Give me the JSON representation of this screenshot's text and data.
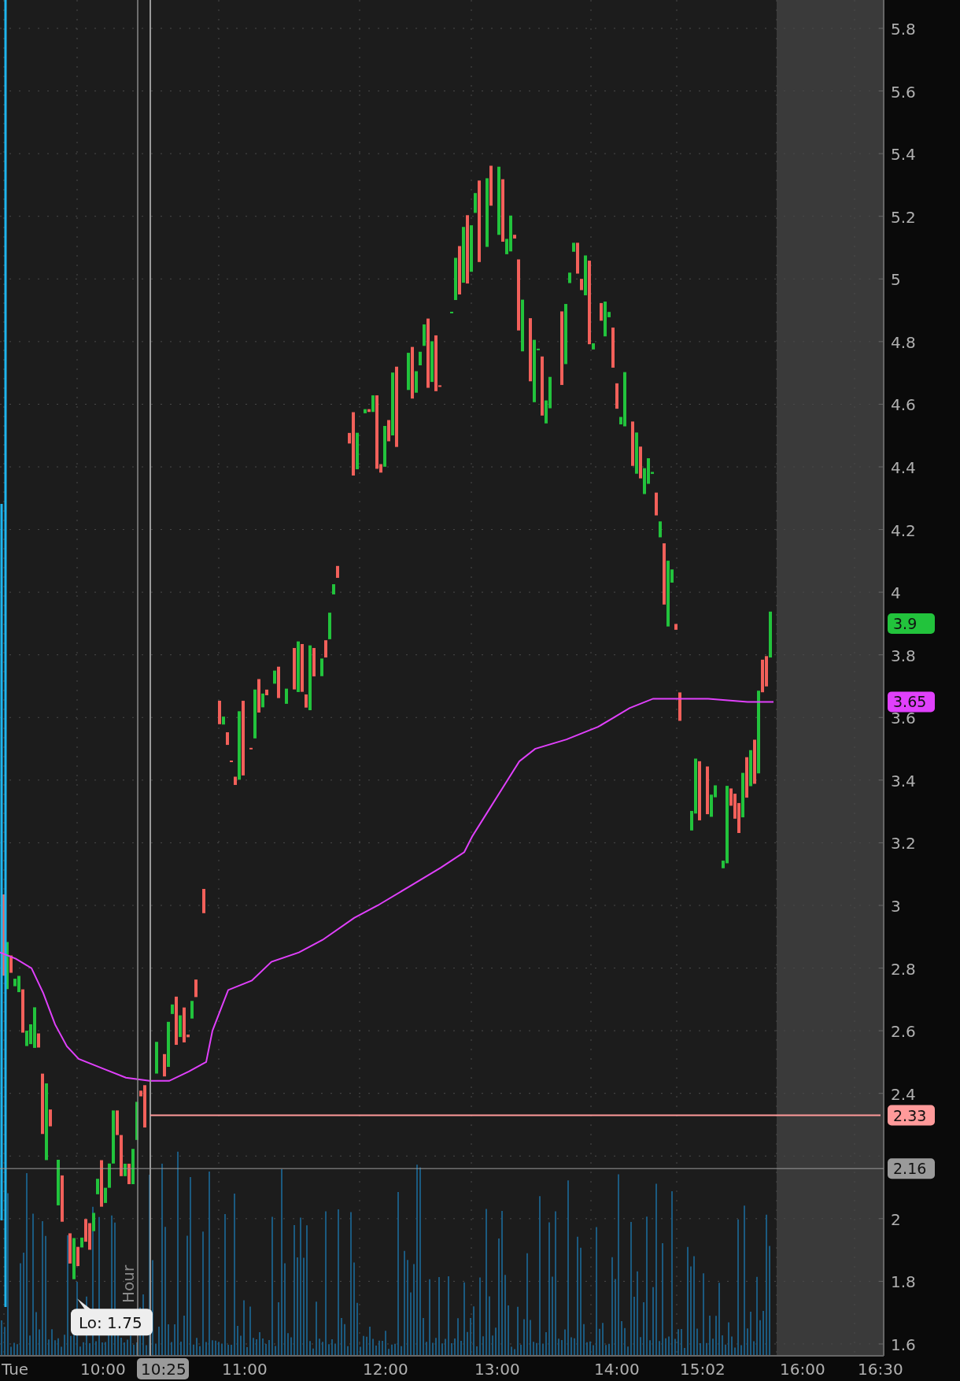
{
  "price_axis": {
    "labels": [
      "5.8",
      "5.6",
      "5.4",
      "5.2",
      "5",
      "4.8",
      "4.6",
      "4.4",
      "4.2",
      "4",
      "3.8",
      "3.6",
      "3.4",
      "3.2",
      "3",
      "2.8",
      "2.6",
      "2.4",
      "2",
      "1.8",
      "1.6"
    ]
  },
  "time_axis": {
    "labels": [
      "Tue",
      "10:00",
      "11:00",
      "12:00",
      "13:00",
      "14:00",
      "15:02",
      "16:00",
      "16:30"
    ]
  },
  "price_tags": [
    {
      "kind": "tag",
      "label": "3.9",
      "color": "#22c33c"
    },
    {
      "kind": "tag",
      "label": "3.65",
      "color": "#e040fb"
    },
    {
      "kind": "level",
      "label": "2.33",
      "color": "#ff9a9a"
    }
  ],
  "crosshair": {
    "price_label": "2.16",
    "time_label": "10:25"
  },
  "session_label": "Hour",
  "low_callout": "Lo: 1.75"
}
